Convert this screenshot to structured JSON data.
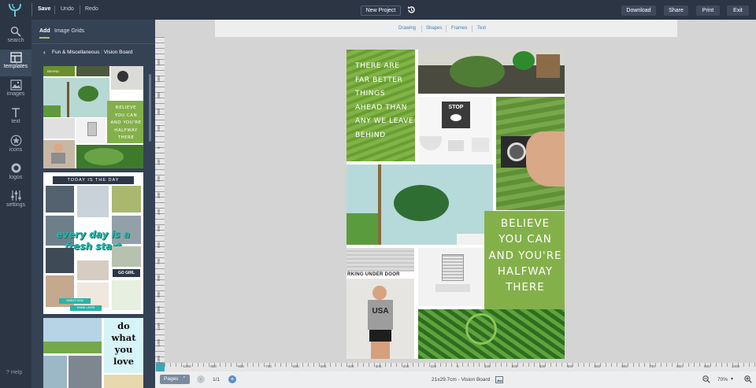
{
  "topbar": {
    "save": "Save",
    "undo": "Undo",
    "redo": "Redo",
    "new_project": "New Project",
    "download": "Download",
    "share": "Share",
    "print": "Print",
    "exit": "Exit"
  },
  "rail": {
    "items": [
      {
        "label": "search",
        "icon": "search-icon"
      },
      {
        "label": "templates",
        "icon": "templates-icon"
      },
      {
        "label": "images",
        "icon": "images-icon"
      },
      {
        "label": "text",
        "icon": "text-icon"
      },
      {
        "label": "icons",
        "icon": "star-icon"
      },
      {
        "label": "logos",
        "icon": "logos-icon"
      },
      {
        "label": "settings",
        "icon": "sliders-icon"
      }
    ],
    "help": "? Help"
  },
  "panel": {
    "tabs": [
      "Add",
      "Image Grids"
    ],
    "breadcrumb": "Fun & Miscellaneous : Vision Board",
    "thumb1": {
      "top_text": "BEHIND",
      "quote": "BELIEVE YOU CAN AND YOU'RE HALFWAY THERE"
    },
    "thumb2": {
      "header": "TODAY IS THE DAY",
      "headline": "every day is a fresh start",
      "tag": "GO GIRL",
      "tag2": "SWEAT NOW",
      "tag3": "SHINE LATER"
    },
    "thumb3": {
      "quote": "do what you love"
    }
  },
  "canvas": {
    "tools": [
      "Drawing",
      "Shapes",
      "Frames",
      "Text"
    ],
    "quote1": "THERE ARE FAR BETTER THINGS AHEAD THAN ANY WE LEAVE BEHIND",
    "quote2": "BELIEVE YOU CAN AND YOU'RE HALFWAY THERE",
    "sign_text": "STOP",
    "street_sign": "RKING UNDER DOOR",
    "shirt_text": "USA"
  },
  "ruler": {
    "h_labels": [
      "-1000",
      "-900",
      "-800",
      "-700",
      "-600",
      "-500",
      "-400",
      "-300",
      "-200",
      "-100",
      "0",
      "100",
      "200",
      "300",
      "400",
      "500",
      "600",
      "700",
      "800",
      "900",
      "1000"
    ],
    "v_labels": [
      "-500",
      "-400",
      "-300",
      "-200",
      "-100",
      "0",
      "100",
      "200",
      "300",
      "400",
      "500",
      "600",
      "700",
      "800",
      "900",
      "1000",
      "1100",
      "1200",
      "1300",
      "1400"
    ]
  },
  "footer": {
    "pages": "Pages",
    "page_count": "1/1",
    "doc_info": "21x29.7cm - Vision Board",
    "zoom": "70%"
  },
  "colors": {
    "topbar": "#2b3544",
    "panel": "#354254",
    "accent_green": "#84b04a",
    "teal": "#2bb3a8"
  }
}
